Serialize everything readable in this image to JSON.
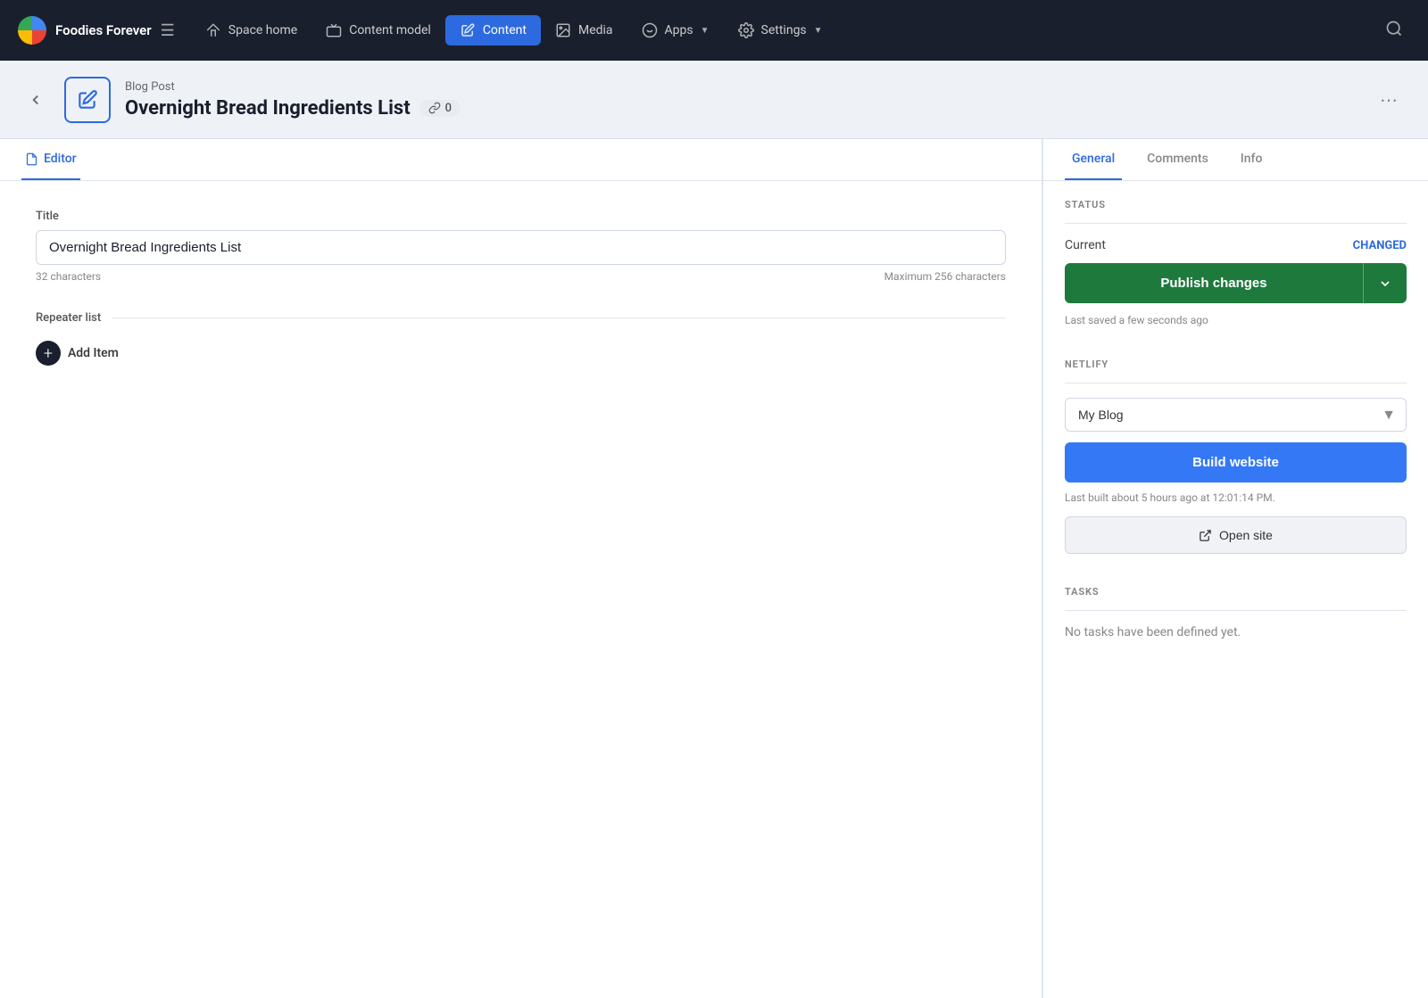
{
  "app": {
    "name": "Foodies Forever"
  },
  "topnav": {
    "items": [
      {
        "id": "space-home",
        "label": "Space home",
        "icon": "home-icon"
      },
      {
        "id": "content-model",
        "label": "Content model",
        "icon": "content-model-icon"
      },
      {
        "id": "content",
        "label": "Content",
        "icon": "content-icon",
        "active": true
      },
      {
        "id": "media",
        "label": "Media",
        "icon": "media-icon"
      },
      {
        "id": "apps",
        "label": "Apps",
        "icon": "apps-icon",
        "hasDropdown": true
      },
      {
        "id": "settings",
        "label": "Settings",
        "icon": "settings-icon",
        "hasDropdown": true
      }
    ]
  },
  "header": {
    "content_type": "Blog Post",
    "title": "Overnight Bread Ingredients List",
    "link_count": "0"
  },
  "editor_tab": {
    "label": "Editor",
    "active": true
  },
  "form": {
    "title_label": "Title",
    "title_value": "Overnight Bread Ingredients List",
    "char_count": "32 characters",
    "char_max": "Maximum 256 characters",
    "repeater_label": "Repeater list",
    "add_item_label": "Add Item"
  },
  "right_panel": {
    "tabs": [
      {
        "id": "general",
        "label": "General",
        "active": true
      },
      {
        "id": "comments",
        "label": "Comments"
      },
      {
        "id": "info",
        "label": "Info"
      }
    ],
    "status": {
      "section_label": "STATUS",
      "current_label": "Current",
      "status_badge": "CHANGED",
      "publish_label": "Publish changes"
    },
    "last_saved": "Last saved a few seconds ago",
    "netlify": {
      "section_label": "NETLIFY",
      "select_value": "My Blog",
      "build_label": "Build website",
      "last_built": "Last built about 5 hours ago at 12:01:14 PM.",
      "open_site_label": "Open site"
    },
    "tasks": {
      "section_label": "TASKS",
      "no_tasks_text": "No tasks have been defined yet."
    }
  }
}
